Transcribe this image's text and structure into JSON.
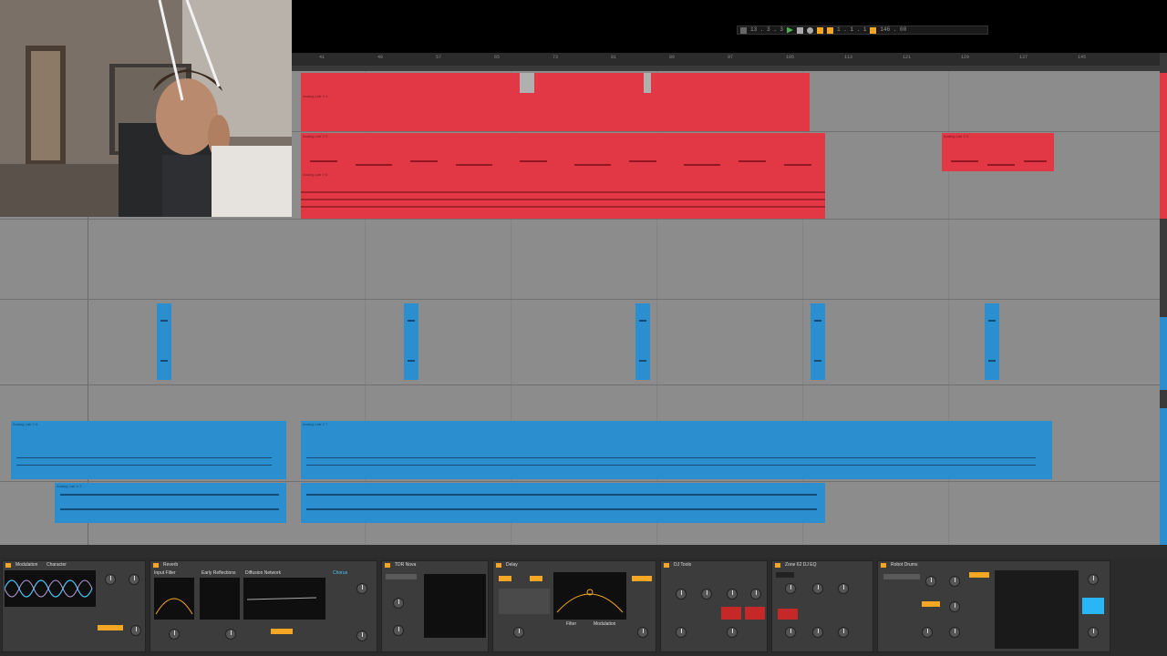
{
  "transport": {
    "position": "13 . 3 . 3",
    "loop_start": "1 . 1 . 1",
    "tempo": "146 . 00"
  },
  "ruler_ticks": [
    "41",
    "49",
    "57",
    "65",
    "73",
    "81",
    "89",
    "97",
    "105",
    "113",
    "121",
    "129",
    "137",
    "145"
  ],
  "clips": [
    {
      "name": "Analog Lab V 4",
      "color": "red"
    },
    {
      "name": "Analog Lab V 5",
      "color": "red"
    },
    {
      "name": "Analog Lab V 5",
      "color": "red"
    },
    {
      "name": "Analog Lab V 6",
      "color": "red"
    },
    {
      "name": "Analog Lab V 6",
      "color": "blue"
    },
    {
      "name": "Analog Lab V 7",
      "color": "blue"
    },
    {
      "name": "Analog Lab V 7",
      "color": "blue"
    }
  ],
  "devices": [
    {
      "title": "Modulation",
      "tab2": "Character"
    },
    {
      "title": "Reverb",
      "input": "Input Filter",
      "early": "Early Reflections",
      "diffusion": "Diffusion Network",
      "chorus": "Chorus"
    },
    {
      "title": "TDR Nova"
    },
    {
      "title": "Delay",
      "filter": "Filter",
      "modulation": "Modulation"
    },
    {
      "title": "DJ Tools"
    },
    {
      "title": "Zone 62 DJ EQ"
    },
    {
      "title": "Robot Drums"
    }
  ],
  "colors": {
    "clip_red": "#e23845",
    "clip_blue": "#2b8fcf",
    "arrangement_bg": "#8c8c8c",
    "accent": "#f5a623"
  }
}
